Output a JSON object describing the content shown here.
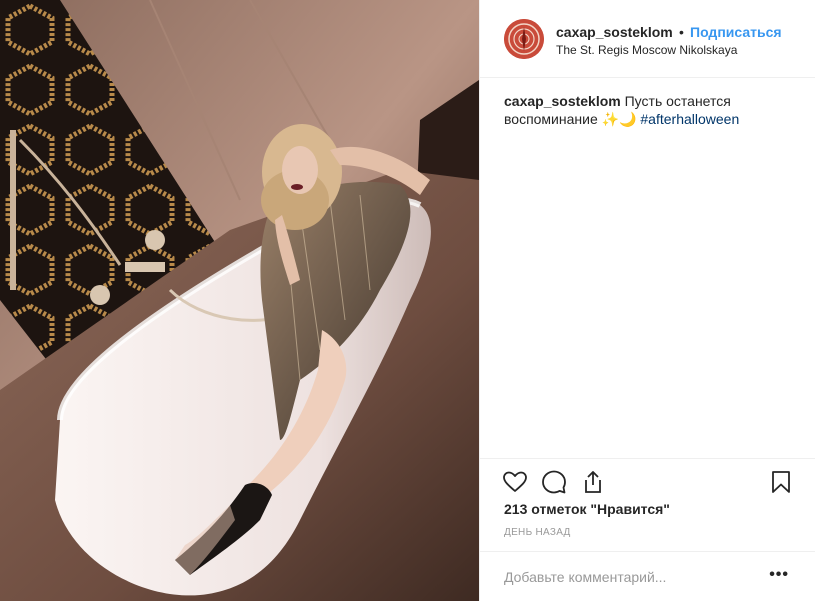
{
  "post": {
    "username": "caxap_sosteklom",
    "separator": "•",
    "follow_label": "Подписаться",
    "location": "The St. Regis Moscow Nikolskaya"
  },
  "caption": {
    "username": "caxap_sosteklom",
    "text": " Пусть останется воспоминание ✨🌙 ",
    "hashtag": "#afterhalloween"
  },
  "actions": {
    "like_icon": "heart-icon",
    "comment_icon": "comment-icon",
    "share_icon": "share-icon",
    "save_icon": "bookmark-icon"
  },
  "likes": "213 отметок \"Нравится\"",
  "timestamp": "ДЕНЬ НАЗАД",
  "comment": {
    "placeholder": "Добавьте комментарий...",
    "more_label": "•••"
  },
  "colors": {
    "link_blue": "#3897f0",
    "hashtag_blue": "#003569",
    "muted": "#999999",
    "divider": "#efefef"
  }
}
